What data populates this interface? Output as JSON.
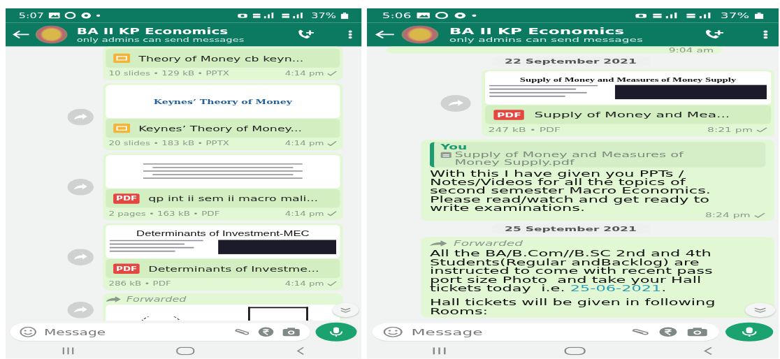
{
  "screens": [
    {
      "status_bar": {
        "time": "5:07",
        "battery": "37%"
      },
      "header": {
        "title": "BA II KP Economics",
        "subtitle": "only admins can send messages"
      },
      "messages": [
        {
          "kind": "slides_file",
          "file_name": "Theory of Money cb keyn...",
          "details": "10 slides • 129 kB • PPTX",
          "time": "4:14 pm",
          "read": false
        },
        {
          "kind": "slides_file",
          "file_name": "Keynes’ Theory of Money...",
          "details": "20 slides • 183 kB • PPTX",
          "time": "4:14 pm",
          "read": false,
          "forward_button": true,
          "preview": {
            "kind": "slide",
            "title": "Keynes’ Theory of Money"
          }
        },
        {
          "kind": "pdf_file",
          "icon_label": "PDF",
          "file_name": "qp int ii sem ii macro mali...",
          "details": "2 pages • 163 kB • PDF",
          "time": "4:14 pm",
          "read": false,
          "forward_button": true,
          "preview": {
            "kind": "lines"
          }
        },
        {
          "kind": "pdf_file",
          "icon_label": "PDF",
          "file_name": "Determinants of Investme...",
          "details": "286 kB • PDF",
          "time": "4:14 pm",
          "read": false,
          "forward_button": true,
          "preview": {
            "kind": "banner",
            "title": "Determinants of Investment-MEC"
          }
        },
        {
          "kind": "forwarded_media",
          "forwarded_label": "Forwarded",
          "forward_button": true
        }
      ],
      "scroll_down_button": true,
      "composer": {
        "placeholder": "Message"
      }
    },
    {
      "status_bar": {
        "time": "5:06",
        "battery": "37%"
      },
      "header": {
        "title": "BA II KP Economics",
        "subtitle": "only admins can send messages"
      },
      "messages": [
        {
          "kind": "time_stub",
          "time": "9:04 am"
        },
        {
          "kind": "date",
          "text": "22 September 2021"
        },
        {
          "kind": "pdf_file",
          "icon_label": "PDF",
          "file_name": "Supply of Money and Mea...",
          "details": "247 kB • PDF",
          "time": "8:21 pm",
          "read": false,
          "forward_button": true,
          "preview": {
            "kind": "article",
            "title": "Supply of Money and Measures of Money Supply"
          }
        },
        {
          "kind": "reply",
          "quote_author": "You",
          "quote_text": "Supply of Money and Measures of\nMoney Supply.pdf",
          "text": "With this I have given you PPTs /\nNotes/Videos for all the topics of\nsecond semester Macro Economics.\nPlease read/watch and get ready to\nwrite examinations.",
          "time": "8:24 pm",
          "read": false
        },
        {
          "kind": "date",
          "text": "25 September 2021"
        },
        {
          "kind": "forwarded_text",
          "forwarded_label": "Forwarded",
          "text_before": "All the BA/B.Com//B.SC 2nd and 4th\nStudents(Regular andBacklog) are\ninstructed to come with recent pass\nport size Photo  and take your Hall\ntickets today  i.e. ",
          "link": "25-06-2021",
          "text_after": ".",
          "second_paragraph": "Hall tickets will be given in following\nRooms:"
        }
      ],
      "scroll_down_button": true,
      "composer": {
        "placeholder": "Message"
      }
    }
  ]
}
